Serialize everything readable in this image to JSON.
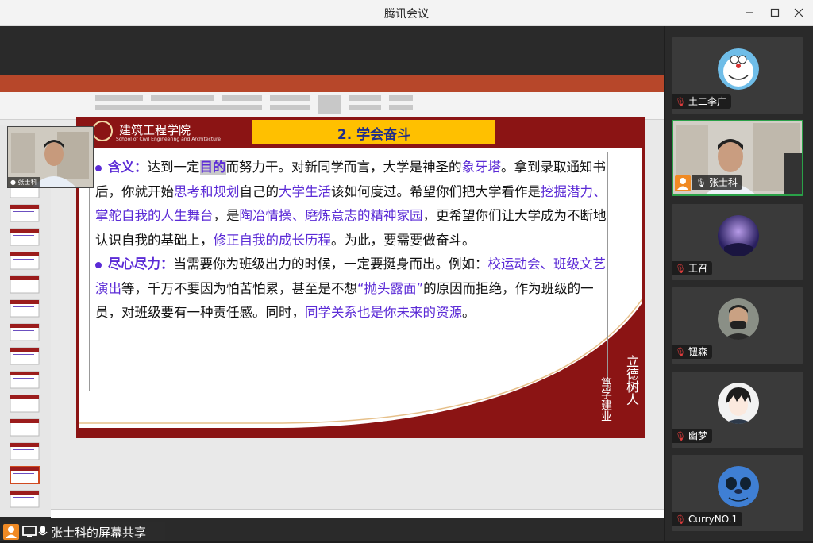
{
  "window": {
    "title": "腾讯会议",
    "buttons": [
      "minimize",
      "maximize",
      "close"
    ]
  },
  "presenter_pip": {
    "name": "张士科"
  },
  "slide": {
    "school_cn": "建筑工程学院",
    "school_en": "School of Civil Engineering and Architecture",
    "title": "2. 学会奋斗",
    "motto1": "立德树人",
    "motto2": "笃学建业",
    "para1": {
      "label": "含义：",
      "t1": "达到一定",
      "k1": "目的",
      "t2": "而努力干。对新同学而言，大学是神圣的",
      "k2": "象牙塔",
      "t3": "。拿到录取通知书后，你就开始",
      "k3": "思考和规划",
      "t4": "自己的",
      "k4": "大学生活",
      "t5": "该如何度过。希望你们把大学看作是",
      "k5": "挖掘潜力、掌舵自我的人生舞台",
      "t6": "，是",
      "k6": "陶冶情操、磨炼意志的精神家园",
      "t7": "，更希望你们让大学成为不断地认识自我的基础上，",
      "k7": "修正自我的成长历程",
      "t8": "。为此，要需要做奋斗。"
    },
    "para2": {
      "label": "尽心尽力：",
      "t1": "当需要你为班级出力的时候，一定要挺身而出。例如：",
      "k1": "校运动会、班级文艺演出",
      "t2": "等，千万不要因为怕苦怕累，甚至是不想",
      "k2": "“抛头露面”",
      "t3": "的原因而拒绝，作为班级的一员，对班级要有一种责任感。同时，",
      "k3": "同学关系也是你未来的资源",
      "t4": "。"
    }
  },
  "share_bar": {
    "text": "张士科的屏幕共享"
  },
  "participants": [
    {
      "name": "土二李广",
      "muted": true,
      "avatar": "doraemon"
    },
    {
      "name": "张士科",
      "muted": false,
      "host": true,
      "avatar": "camera"
    },
    {
      "name": "王召",
      "muted": true,
      "avatar": "anime-night"
    },
    {
      "name": "钮森",
      "muted": true,
      "avatar": "person-mask"
    },
    {
      "name": "幽梦",
      "muted": true,
      "avatar": "anime-boy"
    },
    {
      "name": "CurryNO.1",
      "muted": true,
      "avatar": "stitch"
    }
  ],
  "colors": {
    "accent_purple": "#5b2bd6",
    "slide_red": "#8b1414",
    "title_yellow": "#ffc000",
    "active_green": "#2aa148"
  }
}
